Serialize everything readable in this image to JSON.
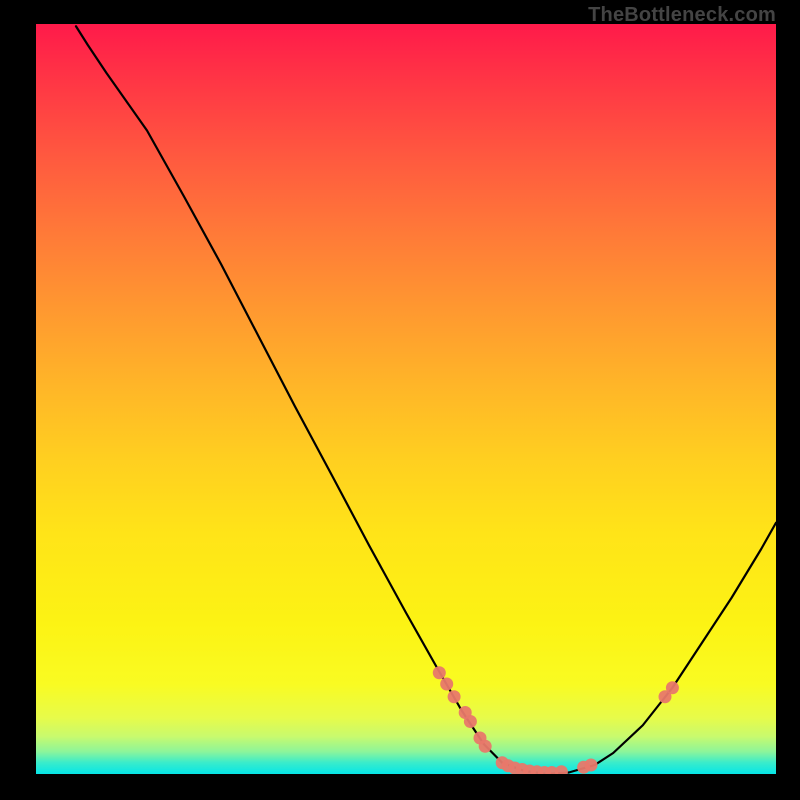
{
  "watermark": "TheBottleneck.com",
  "chart_data": {
    "type": "line",
    "title": "",
    "xlabel": "",
    "ylabel": "",
    "xlim": [
      0,
      100
    ],
    "ylim": [
      0,
      100
    ],
    "curve": [
      {
        "x": 5.4,
        "y": 99.7
      },
      {
        "x": 7.0,
        "y": 97.2
      },
      {
        "x": 9.5,
        "y": 93.5
      },
      {
        "x": 12.0,
        "y": 90.0
      },
      {
        "x": 15.0,
        "y": 85.8
      },
      {
        "x": 20.0,
        "y": 77.0
      },
      {
        "x": 25.0,
        "y": 68.0
      },
      {
        "x": 30.0,
        "y": 58.5
      },
      {
        "x": 35.0,
        "y": 49.0
      },
      {
        "x": 40.0,
        "y": 39.8
      },
      {
        "x": 45.0,
        "y": 30.5
      },
      {
        "x": 50.0,
        "y": 21.5
      },
      {
        "x": 54.0,
        "y": 14.5
      },
      {
        "x": 57.5,
        "y": 8.5
      },
      {
        "x": 60.5,
        "y": 4.0
      },
      {
        "x": 63.0,
        "y": 1.5
      },
      {
        "x": 66.0,
        "y": 0.4
      },
      {
        "x": 69.0,
        "y": 0.0
      },
      {
        "x": 72.0,
        "y": 0.2
      },
      {
        "x": 75.5,
        "y": 1.2
      },
      {
        "x": 78.0,
        "y": 2.8
      },
      {
        "x": 82.0,
        "y": 6.5
      },
      {
        "x": 86.0,
        "y": 11.5
      },
      {
        "x": 90.0,
        "y": 17.5
      },
      {
        "x": 94.0,
        "y": 23.5
      },
      {
        "x": 98.0,
        "y": 30.0
      },
      {
        "x": 100.0,
        "y": 33.5
      }
    ],
    "points": [
      {
        "x": 54.5,
        "y": 13.5
      },
      {
        "x": 55.5,
        "y": 12.0
      },
      {
        "x": 56.5,
        "y": 10.3
      },
      {
        "x": 58.0,
        "y": 8.2
      },
      {
        "x": 58.7,
        "y": 7.0
      },
      {
        "x": 60.0,
        "y": 4.8
      },
      {
        "x": 60.7,
        "y": 3.7
      },
      {
        "x": 63.0,
        "y": 1.5
      },
      {
        "x": 63.8,
        "y": 1.1
      },
      {
        "x": 64.7,
        "y": 0.8
      },
      {
        "x": 65.7,
        "y": 0.6
      },
      {
        "x": 66.7,
        "y": 0.4
      },
      {
        "x": 67.7,
        "y": 0.3
      },
      {
        "x": 68.7,
        "y": 0.2
      },
      {
        "x": 69.7,
        "y": 0.2
      },
      {
        "x": 71.0,
        "y": 0.3
      },
      {
        "x": 74.0,
        "y": 0.9
      },
      {
        "x": 75.0,
        "y": 1.2
      },
      {
        "x": 85.0,
        "y": 10.3
      },
      {
        "x": 86.0,
        "y": 11.5
      }
    ],
    "legend_on": false,
    "grid_on": false
  }
}
